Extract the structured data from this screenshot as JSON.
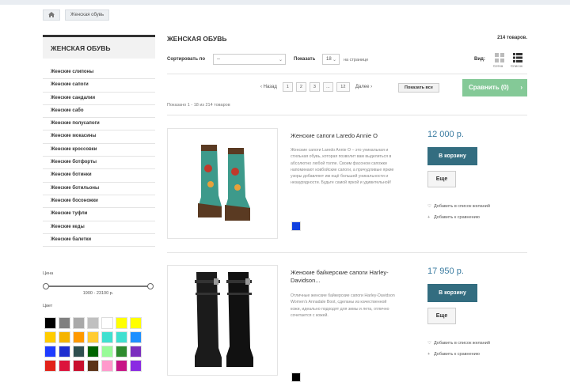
{
  "breadcrumb": {
    "current": "Женская обувь"
  },
  "sidebar": {
    "title": "ЖЕНСКАЯ ОБУВЬ",
    "items": [
      "Женские слипоны",
      "Женские сапоги",
      "Женские сандалии",
      "Женские сабо",
      "Женские полусапоги",
      "Женские мокасины",
      "Женские кроссовки",
      "Женские ботфорты",
      "Женские ботинки",
      "Женские ботильоны",
      "Женские босоножки",
      "Женские туфли",
      "Женские кеды",
      "Женские балетки"
    ],
    "price_label": "Цена",
    "price_range": "1900 - 23100 р.",
    "price_slider": {
      "min": 0.0,
      "max": 1.0
    },
    "color_label": "Цвет",
    "colors": [
      "#000000",
      "#808080",
      "#a9a9a9",
      "#c0c0c0",
      "#ffffff",
      "#ffff00",
      "#ffff00",
      "#ffcc00",
      "#f5b400",
      "#ff9900",
      "#ffcc33",
      "#40e0d0",
      "#40e0d0",
      "#1e90ff",
      "#1e3cff",
      "#1f2fd0",
      "#2f4f4f",
      "#006400",
      "#98fb98",
      "#2e8b2e",
      "#7b2fbe",
      "#e2231a",
      "#dc143c",
      "#c8102e",
      "#5c3317",
      "#ff99cc",
      "#c71585",
      "#8a2be2"
    ]
  },
  "main": {
    "title": "ЖЕНСКАЯ ОБУВЬ",
    "count": "214 товаров.",
    "sort_label": "Сортировать по",
    "sort_value": "--",
    "show_label": "Показать",
    "show_value": "18",
    "per_page": "на странице",
    "view_label": "Вид:",
    "view_grid": "Сетка",
    "view_list": "Список",
    "pager": {
      "prev": "‹ Назад",
      "pages": [
        "1",
        "2",
        "3",
        "...",
        "12"
      ],
      "next": "Далее ›"
    },
    "show_all": "Показать все",
    "compare": "Сравнить (0)",
    "shown": "Показано 1 - 18 из 214 товаров"
  },
  "products": [
    {
      "name": "Женские сапоги Laredo Annie O",
      "desc": "Женские сапоги Laredo Annie O – это уникальная и стильная обувь, которая позволит вам выделиться в абсолютно любой толпе. Своим фасоном сапожки напоминают ковбойские сапоги, а причудливые яркие узоры добавляют им ещё большей уникальности и незаурядности. Будьте самой яркой и удивительной!",
      "color": "#1040e0",
      "price": "12 000 р.",
      "cart": "В корзину",
      "more": "Еще",
      "wishlist": "Добавить в список желаний",
      "compare": "Добавить к сравнению"
    },
    {
      "name": "Женские байкерские сапоги Harley-Davidson...",
      "desc": "Отличные женские байкерские сапоги Harley-Davidson Women's Annadale Boot, сделаны из качественной кожи, идеально подходят для зимы и лета, отлично сочетается с кожей.",
      "color": "#000000",
      "price": "17 950 р.",
      "cart": "В корзину",
      "more": "Еще",
      "wishlist": "Добавить в список желаний",
      "compare": "Добавить к сравнению"
    }
  ]
}
